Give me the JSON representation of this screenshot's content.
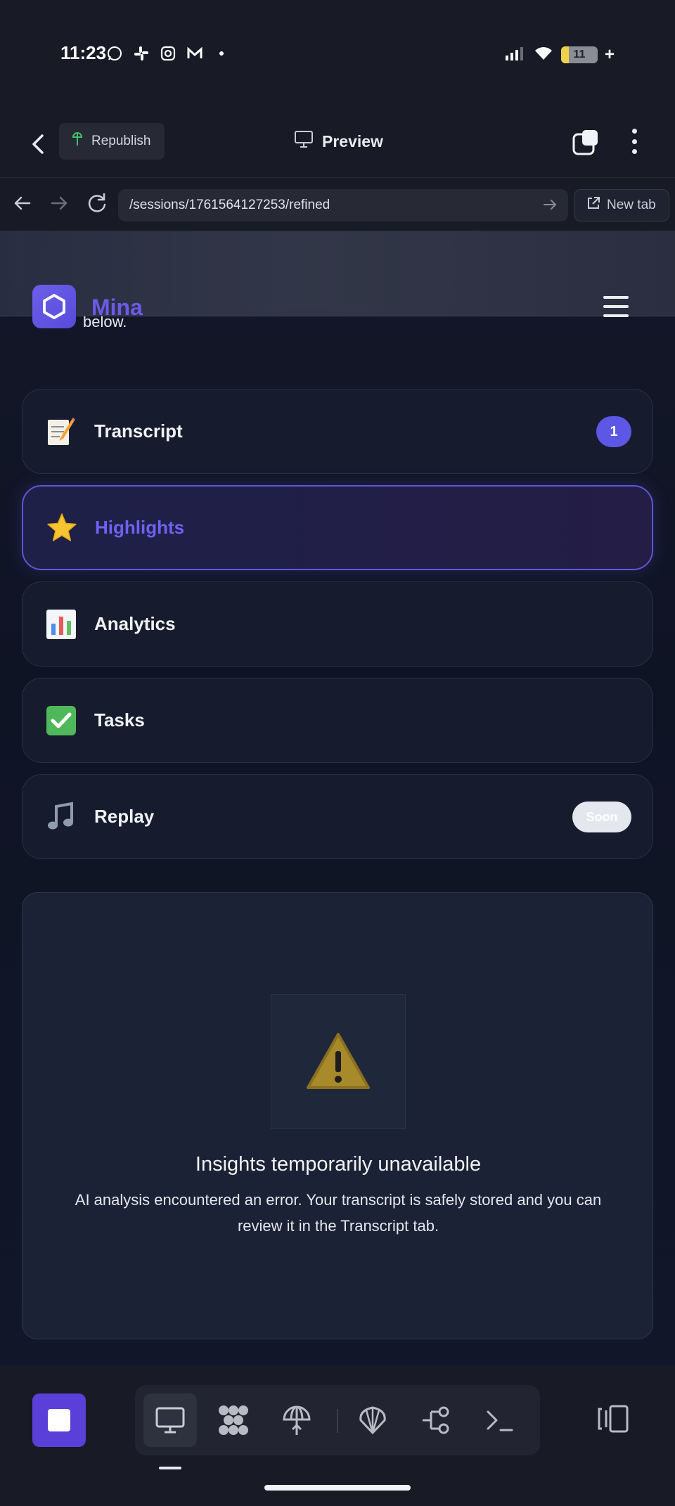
{
  "status_bar": {
    "time": "11:23",
    "battery": "11",
    "notification_icons": [
      "whatsapp-icon",
      "slack-icon",
      "instagram-icon",
      "gmail-icon",
      "dot-icon"
    ]
  },
  "app_header": {
    "republish_label": "Republish",
    "preview_label": "Preview"
  },
  "browser": {
    "url": "/sessions/1761564127253/refined",
    "new_tab_label": "New tab"
  },
  "site": {
    "brand": "Mina",
    "top_card_text": "below.",
    "nav_items": [
      {
        "emoji": "📝",
        "label": "Transcript",
        "badge": "1"
      },
      {
        "emoji": "⭐",
        "label": "Highlights"
      },
      {
        "emoji": "📊",
        "label": "Analytics"
      },
      {
        "emoji": "✅",
        "label": "Tasks"
      },
      {
        "emoji": "🎵",
        "label": "Replay",
        "badge": "Soon"
      }
    ],
    "active_nav": "Highlights",
    "insights": {
      "icon": "warning-icon",
      "title": "Insights temporarily unavailable",
      "description": "AI analysis encountered an error. Your transcript is safely stored and you can review it in the Transcript tab."
    }
  },
  "bottom_toolbar": {
    "tools": [
      "preview-tool",
      "grid-tool",
      "deploy-tool",
      "shell-tool",
      "flow-tool",
      "terminal-tool"
    ]
  },
  "colors": {
    "accent": "#5d57e6",
    "brand": "#6d5df0",
    "stop_button": "#5a40d8"
  }
}
